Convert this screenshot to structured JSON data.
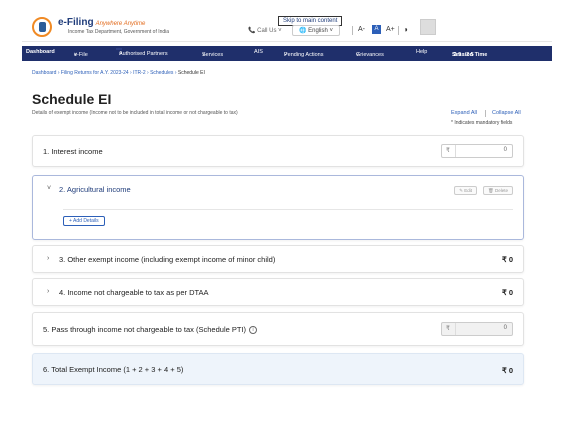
{
  "header": {
    "brand_title": "e-Filing",
    "brand_tagline": "Anywhere Anytime",
    "brand_subtitle": "Income Tax Department, Government of India",
    "skip_link": "Skip to main content",
    "call_us": "Call Us",
    "language": "English",
    "font_decrease": "A-",
    "font_normal": "A",
    "font_increase": "A+",
    "contrast_glyph": "◑"
  },
  "nav": {
    "items": [
      "Dashboard",
      "e-File",
      "Authorised Partners",
      "Services",
      "AIS",
      "Pending Actions",
      "Grievances",
      "Help"
    ],
    "dropdown_mark": "˅",
    "session_label": "Session Time",
    "session_value": "2 9 : 2 5"
  },
  "breadcrumb": {
    "items": [
      "Dashboard",
      "Filing Returns for A.Y. 2023-24",
      "ITR-2",
      "Schedules"
    ],
    "current": "Schedule EI",
    "separator": "›"
  },
  "page": {
    "title": "Schedule EI",
    "subtitle": "Details of exempt income (Income not to be included in total income or not chargeable to tax)",
    "expand_all": "Expand All",
    "collapse_all": "Collapse All",
    "mandatory_note": "* Indicates mandatory fields"
  },
  "rows": {
    "interest_label": "1. Interest income",
    "interest_value": "0",
    "agri_label": "2. Agricultural income",
    "edit_btn": "✎ Edit",
    "delete_btn": "🗑 Delete",
    "add_details": "+ Add Details",
    "other_label": "3. Other exempt income (including exempt income of minor child)",
    "other_amount": "₹ 0",
    "dtaa_label": "4. Income not chargeable to tax as per DTAA",
    "dtaa_amount": "₹ 0",
    "pti_label": "5. Pass through income not chargeable to tax (Schedule PTI)",
    "pti_value": "0",
    "total_label": "6. Total Exempt Income (1 + 2 + 3 + 4 + 5)",
    "total_amount": "₹ 0",
    "rupee": "₹",
    "chevron_right": "›",
    "chevron_down": "˅",
    "info_glyph": "i"
  },
  "colors": {
    "nav_bg": "#1f2f6b",
    "link": "#2c5fb8",
    "total_bg": "#eef4fb"
  }
}
